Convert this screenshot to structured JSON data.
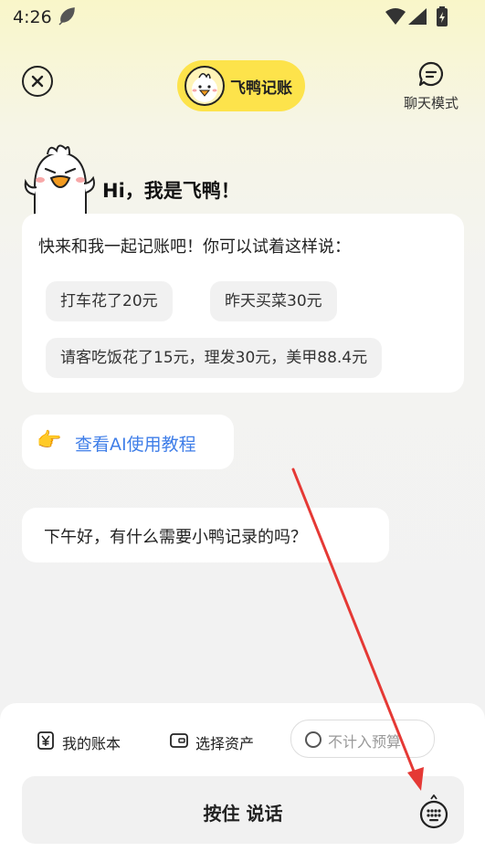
{
  "status_bar": {
    "time": "4:26"
  },
  "header": {
    "app_title": "飞鸭记账",
    "chat_mode_label": "聊天模式"
  },
  "greeting": "Hi，我是飞鸭！",
  "intro_card": {
    "text": "快来和我一起记账吧！你可以试着这样说：",
    "suggestions": [
      "打车花了20元",
      "昨天买菜30元",
      "请客吃饭花了15元，理发30元，美甲88.4元"
    ]
  },
  "guide_link": "查看AI使用教程",
  "assistant_message": "下午好，有什么需要小鸭记录的吗？",
  "bottom": {
    "ledger_label": "我的账本",
    "asset_label": "选择资产",
    "budget_label": "不计入预算",
    "hold_to_talk": "按住 说话"
  },
  "colors": {
    "brand_yellow": "#fde34b",
    "link_blue": "#3f7ee8",
    "annotation_red": "#e53935"
  }
}
